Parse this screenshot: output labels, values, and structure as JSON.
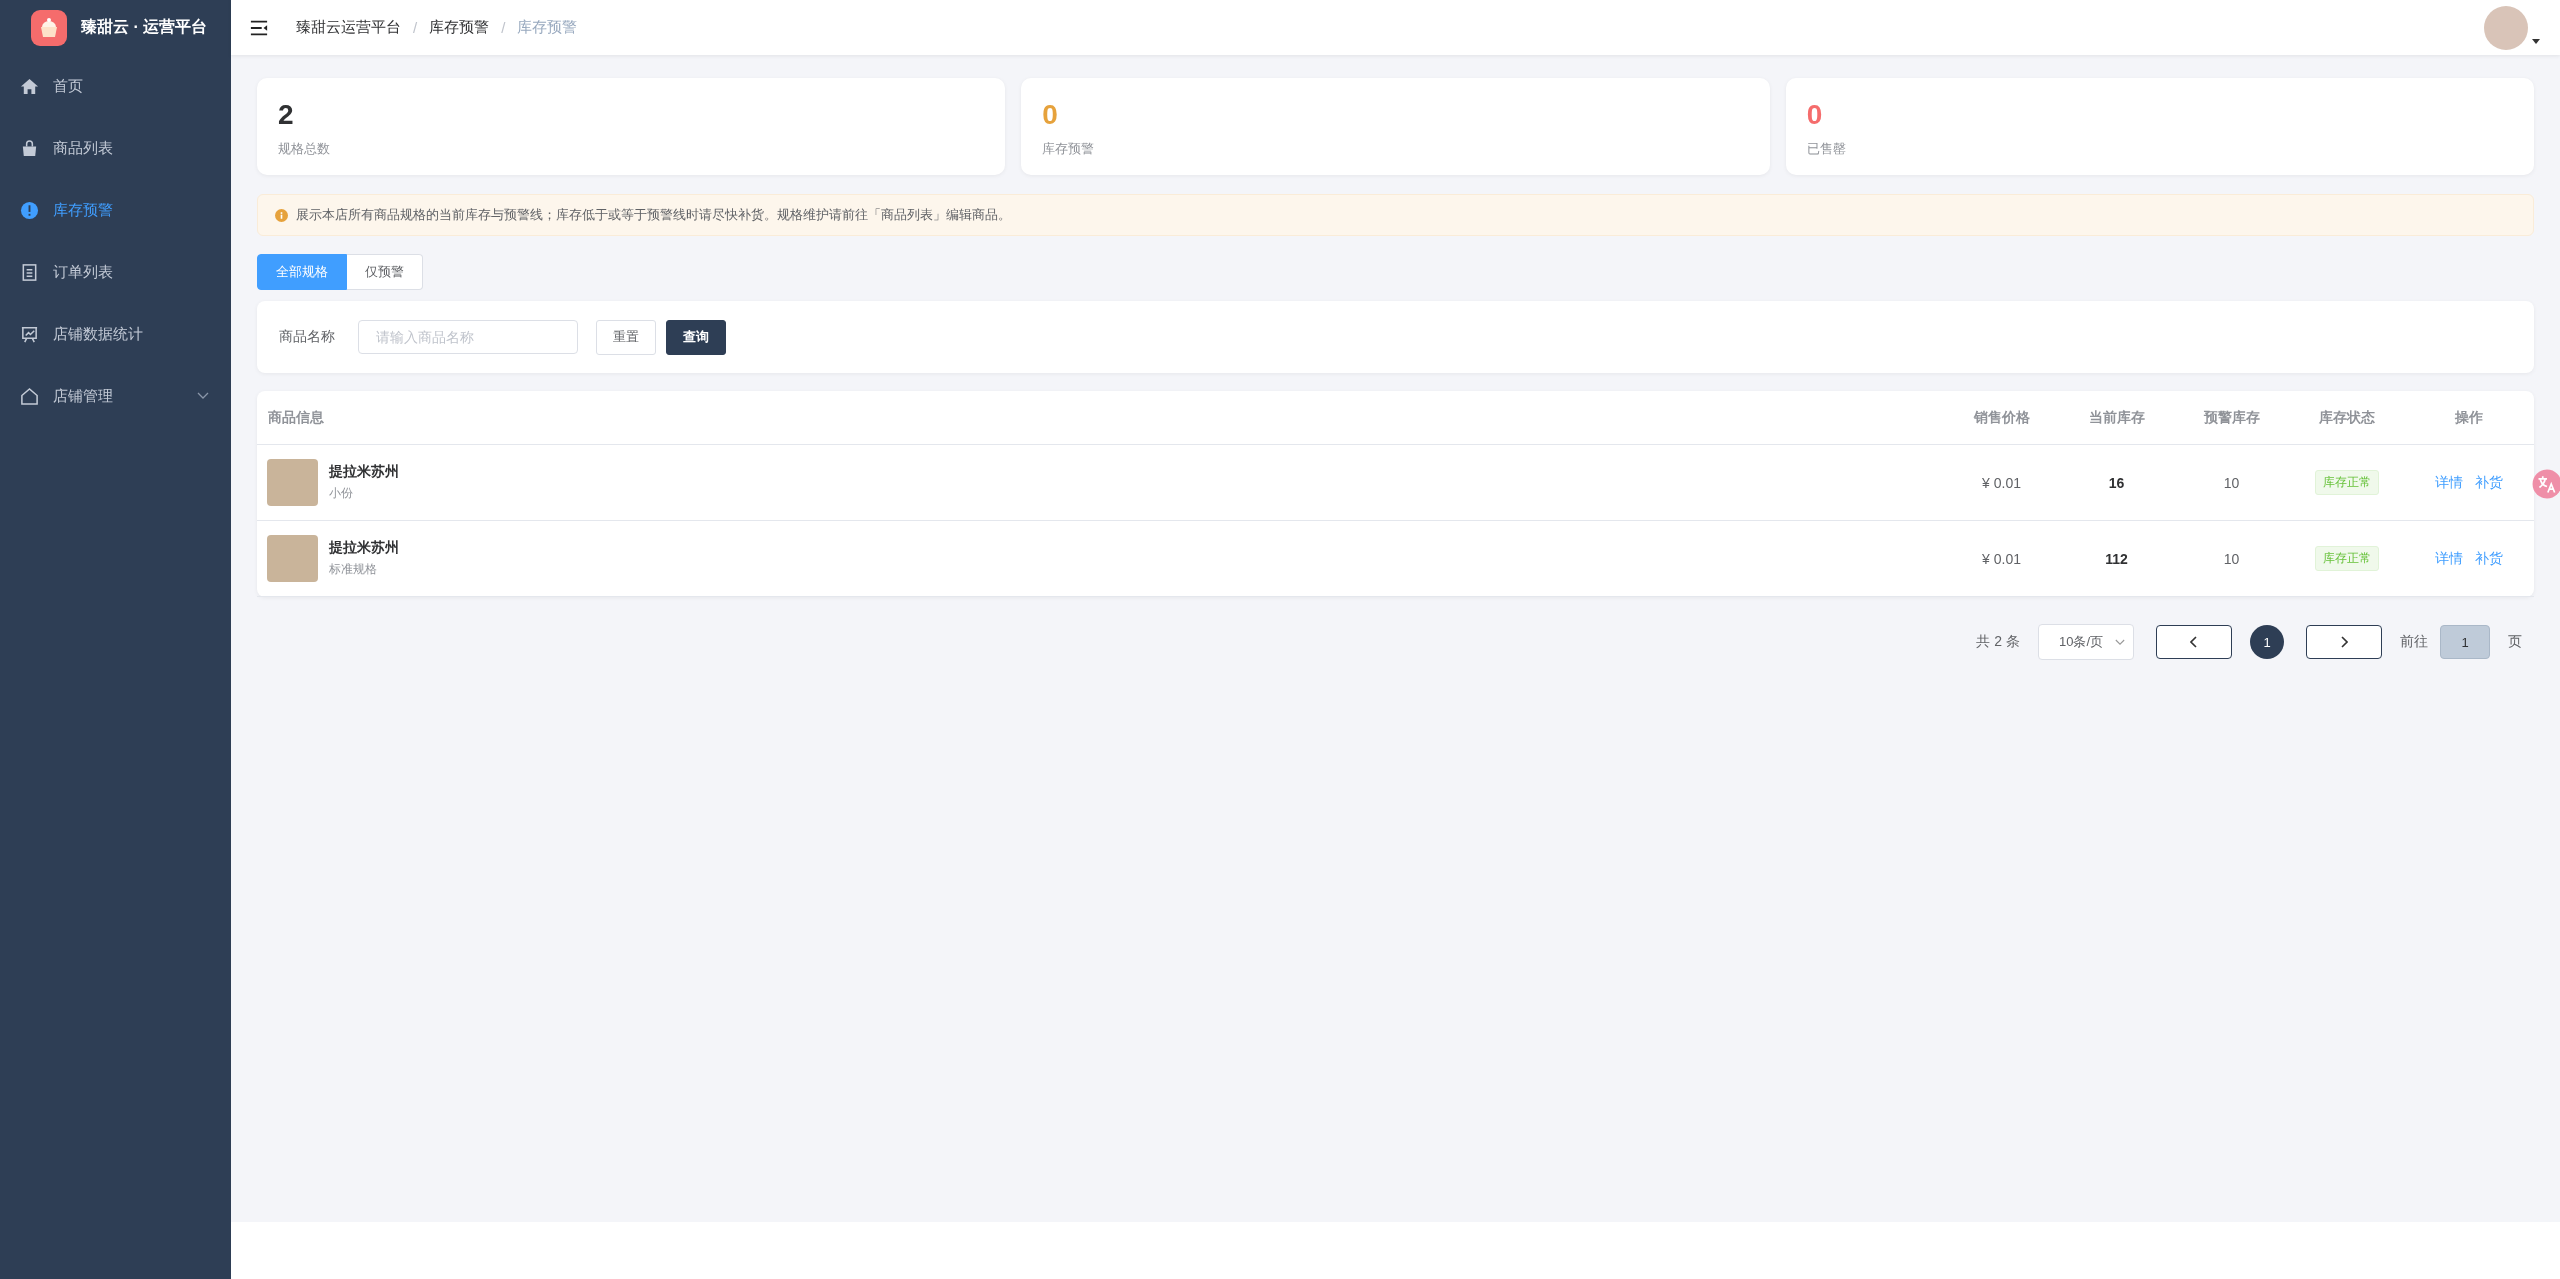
{
  "sidebar": {
    "brand": "臻甜云 · 运营平台",
    "items": [
      {
        "label": "首页",
        "kind": "home",
        "selected": false,
        "expandable": false
      },
      {
        "label": "商品列表",
        "kind": "bag",
        "selected": false,
        "expandable": false
      },
      {
        "label": "库存预警",
        "kind": "alert",
        "selected": true,
        "expandable": false
      },
      {
        "label": "订单列表",
        "kind": "doc",
        "selected": false,
        "expandable": false
      },
      {
        "label": "店铺数据统计",
        "kind": "chart",
        "selected": false,
        "expandable": false
      },
      {
        "label": "店铺管理",
        "kind": "shop",
        "selected": false,
        "expandable": true
      }
    ]
  },
  "header": {
    "breadcrumbs": [
      {
        "label": "臻甜云运营平台",
        "current": false
      },
      {
        "label": "库存预警",
        "current": false
      },
      {
        "label": "库存预警",
        "current": true
      }
    ],
    "separator": "/"
  },
  "stats": [
    {
      "value": "2",
      "label": "规格总数",
      "color": "#303133"
    },
    {
      "value": "0",
      "label": "库存预警",
      "color": "#e6a23c"
    },
    {
      "value": "0",
      "label": "已售罄",
      "color": "#f56c6c"
    }
  ],
  "notice": "展示本店所有商品规格的当前库存与预警线；库存低于或等于预警线时请尽快补货。规格维护请前往「商品列表」编辑商品。",
  "tabs": [
    {
      "label": "全部规格",
      "selected": true
    },
    {
      "label": "仅预警",
      "selected": false
    }
  ],
  "search": {
    "label": "商品名称",
    "placeholder": "请输入商品名称",
    "buttons": [
      {
        "label": "重置",
        "primary": false
      },
      {
        "label": "查询",
        "primary": true
      }
    ]
  },
  "table": {
    "columns": [
      "商品信息",
      "销售价格",
      "当前库存",
      "预警库存",
      "库存状态",
      "操作"
    ],
    "rows": [
      {
        "name": "提拉米苏州",
        "spec": "小份",
        "price": "¥ 0.01",
        "stock": "16",
        "warn": "10",
        "status": "库存正常",
        "actions": [
          "详情",
          "补货"
        ]
      },
      {
        "name": "提拉米苏州",
        "spec": "标准规格",
        "price": "¥ 0.01",
        "stock": "112",
        "warn": "10",
        "status": "库存正常",
        "actions": [
          "详情",
          "补货"
        ]
      }
    ]
  },
  "pagination": {
    "total": "共 2 条",
    "page_size": "10条/页",
    "pages": [
      {
        "label": "1",
        "selected": true
      }
    ],
    "goto_label": "前往",
    "goto_value": "1",
    "page_suffix": "页"
  }
}
